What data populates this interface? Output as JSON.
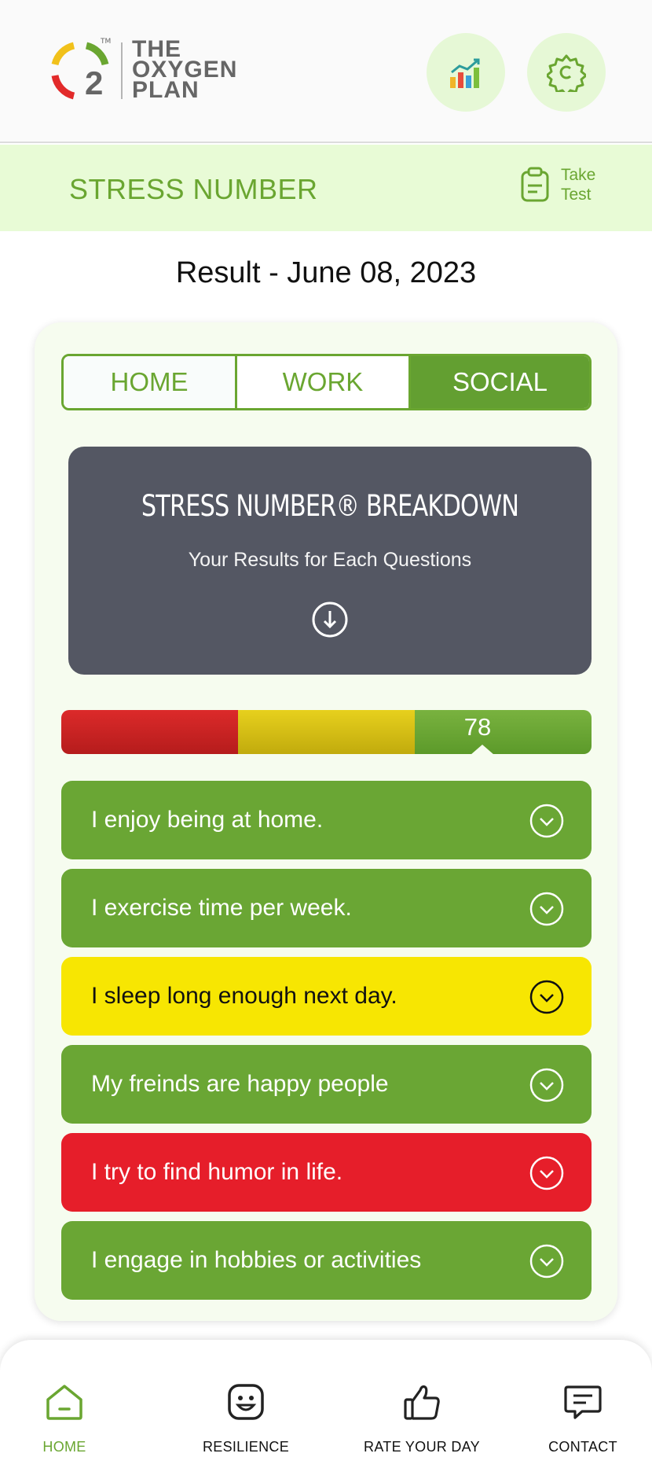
{
  "brand": {
    "logo_numeral": "2",
    "logo_tm": "TM",
    "logo_lines": [
      "THE",
      "OXYGEN",
      "PLAN"
    ]
  },
  "header": {
    "actions": [
      {
        "icon": "bar-chart-icon"
      },
      {
        "icon": "gear-icon"
      }
    ]
  },
  "section": {
    "title": "STRESS NUMBER",
    "take_test_label": "Take Test",
    "take_test_icon": "clipboard-icon"
  },
  "result": {
    "title": "Result - June 08, 2023"
  },
  "tabs": [
    {
      "label": "HOME",
      "active": false
    },
    {
      "label": "WORK",
      "active": false
    },
    {
      "label": "SOCIAL",
      "active": true
    }
  ],
  "breakdown": {
    "title": "STRESS NUMBER® BREAKDOWN",
    "subtitle": "Your Results for Each Questions",
    "icon": "arrow-down-circle-icon"
  },
  "score": {
    "value": "78",
    "segments": [
      "red",
      "yellow",
      "green"
    ]
  },
  "questions": [
    {
      "text": "I enjoy being at home.",
      "status": "green"
    },
    {
      "text": "I exercise time per week.",
      "status": "green"
    },
    {
      "text": "I sleep long enough  next day.",
      "status": "yellow"
    },
    {
      "text": "My freinds are happy people",
      "status": "green"
    },
    {
      "text": "I try to find humor in life.",
      "status": "red"
    },
    {
      "text": "I engage in hobbies or activities",
      "status": "green"
    }
  ],
  "colors": {
    "accent": "#6aa631",
    "band": "#e8fbd6",
    "dark_card": "#545763",
    "green": "#6aa634",
    "yellow": "#f7e602",
    "red": "#e61e2a"
  },
  "nav": [
    {
      "label": "HOME",
      "icon": "home-icon",
      "active": true
    },
    {
      "label": "RESILIENCE",
      "icon": "smiley-icon",
      "active": false
    },
    {
      "label": "RATE YOUR DAY",
      "icon": "thumbs-up-icon",
      "active": false
    },
    {
      "label": "CONTACT",
      "icon": "chat-icon",
      "active": false
    }
  ]
}
